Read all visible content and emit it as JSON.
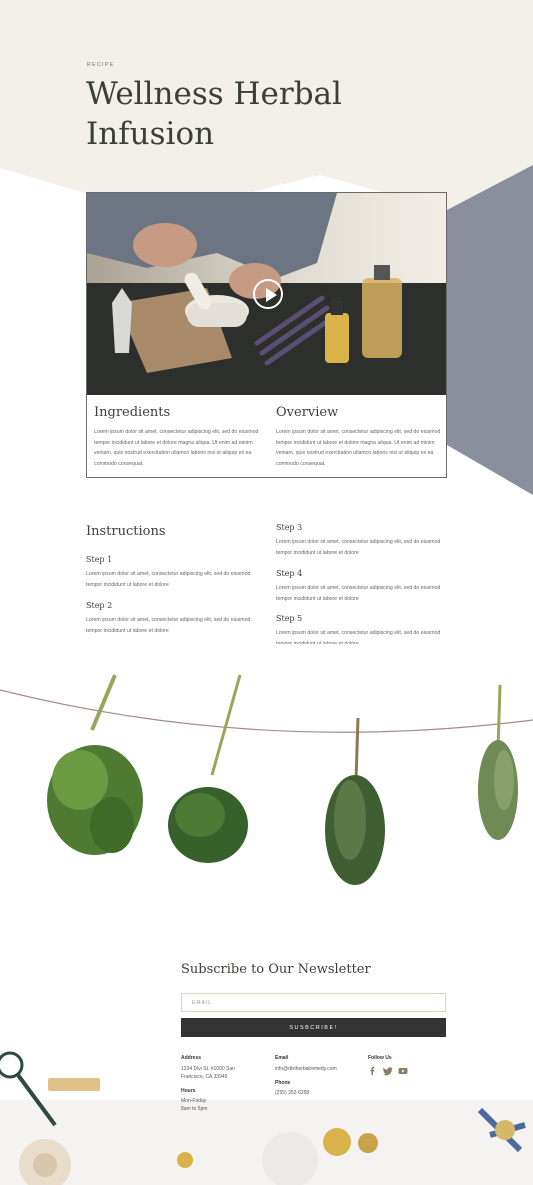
{
  "header": {
    "eyebrow": "RECIPE",
    "title": "Wellness Herbal Infusion"
  },
  "card": {
    "video_icon": "play-icon",
    "ingredients": {
      "heading": "Ingredients",
      "body": "Lorem ipsum dolor sit amet, consectetur adipiscing elit, sed do eiusmod tempor incididunt ut labore et dolore magna aliqua. Ut enim ad minim veniam, quis nostrud exercitation ullamco laboris nisi ut aliquip ex ea commodo consequat."
    },
    "overview": {
      "heading": "Overview",
      "body": "Lorem ipsum dolor sit amet, consectetur adipiscing elit, sed do eiusmod tempor incididunt ut labore et dolore magna aliqua. Ut enim ad minim veniam, quis nostrud exercitation ullamco laboris nisi ut aliquip ex ea commodo consequat."
    }
  },
  "instructions": {
    "heading": "Instructions",
    "steps": [
      {
        "label": "Step 1",
        "text": "Lorem ipsum dolor sit amet, consectetur adipiscing elit, sed do eiusmod tempor incididunt ut labore et dolore"
      },
      {
        "label": "Step 2",
        "text": "Lorem ipsum dolor sit amet, consectetur adipiscing elit, sed do eiusmod tempor incididunt ut labore et dolore"
      },
      {
        "label": "Step 3",
        "text": "Lorem ipsum dolor sit amet, consectetur adipiscing elit, sed do eiusmod tempor incididunt ut labore et dolore"
      },
      {
        "label": "Step 4",
        "text": "Lorem ipsum dolor sit amet, consectetur adipiscing elit, sed do eiusmod tempor incididunt ut labore et dolore"
      },
      {
        "label": "Step 5",
        "text": "Lorem ipsum dolor sit amet, consectetur adipiscing elit, sed do eiusmod tempor incididunt ut labore et dolore"
      }
    ]
  },
  "newsletter": {
    "heading": "Subscribe to Our Newsletter",
    "email_placeholder": "EMAIL",
    "button": "SUSBCRIBE!"
  },
  "footer": {
    "address_label": "Address",
    "address": "1234 Divi St. #1000 San Francisco, CA 33945",
    "hours_label": "Hours",
    "hours": "Mon-Friday 8am to 5pm",
    "email_label": "Email",
    "email": "info@diviherbalremedy.com",
    "phone_label": "Phone",
    "phone": "(255) 352-6258",
    "follow_label": "Follow Us",
    "social_icons": [
      "facebook-icon",
      "twitter-icon",
      "youtube-icon"
    ]
  },
  "colors": {
    "cream": "#f3f0ea",
    "slate": "#8a8f9c",
    "dark": "#333333",
    "text_dark": "#3b3f38"
  }
}
